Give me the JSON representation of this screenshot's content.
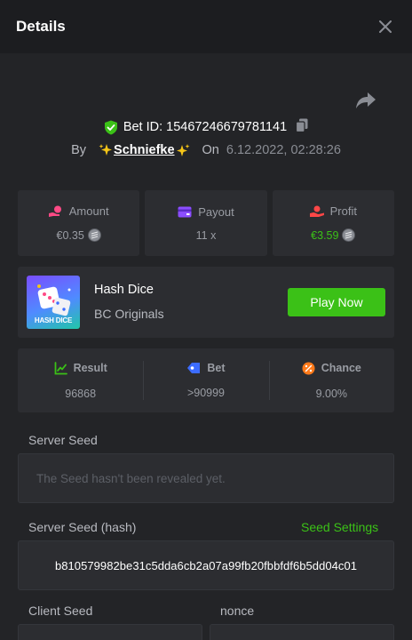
{
  "header": {
    "title": "Details"
  },
  "bet": {
    "id_text": "Bet ID: 15467246679781141",
    "by_label": "By",
    "username": "Schniefke",
    "on_label": "On",
    "date": "6.12.2022, 02:28:26"
  },
  "stats": {
    "amount": {
      "label": "Amount",
      "value": "€0.35"
    },
    "payout": {
      "label": "Payout",
      "value": "11 x"
    },
    "profit": {
      "label": "Profit",
      "value": "€3.59"
    }
  },
  "game": {
    "thumb_label": "HASH DICE",
    "name": "Hash Dice",
    "provider": "BC Originals",
    "play_label": "Play Now"
  },
  "result": {
    "result": {
      "label": "Result",
      "value": "96868"
    },
    "bet": {
      "label": "Bet",
      "value": ">90999"
    },
    "chance": {
      "label": "Chance",
      "value": "9.00%"
    }
  },
  "server_seed": {
    "label": "Server Seed",
    "placeholder": "The Seed hasn't been revealed yet."
  },
  "server_seed_hash": {
    "label": "Server Seed (hash)",
    "settings_label": "Seed Settings",
    "value": "b810579982be31c5dda6cb2a07a99fb20fbbfdf6b5dd04c01"
  },
  "client_seed": {
    "label": "Client Seed"
  },
  "nonce": {
    "label": "nonce"
  },
  "colors": {
    "accent_green": "#3bc117",
    "amount_icon": "#ff4a86",
    "payout_icon": "#8b4dff",
    "profit_icon": "#ff4747",
    "bet_icon": "#3c6cff",
    "chance_icon": "#ff7a1a"
  },
  "icons": [
    "close-icon",
    "share-icon",
    "shield-check-icon",
    "copy-icon",
    "sparkle-icon",
    "amount-icon",
    "payout-icon",
    "profit-icon",
    "coin-icon",
    "result-icon",
    "bet-icon",
    "chance-icon"
  ]
}
